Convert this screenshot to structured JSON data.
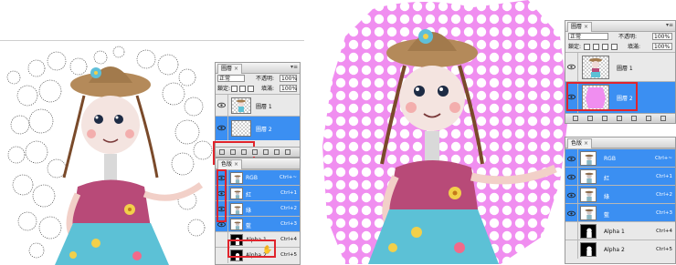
{
  "layers_panel": {
    "tab_label": "圖層",
    "close_glyph": "×",
    "menu_glyph": "▾≡",
    "blend_mode": "正常",
    "opacity_label": "不透明:",
    "opacity_value": "100%",
    "lock_label": "鎖定:",
    "fill_label": "填滿:",
    "fill_value": "100%",
    "layers": [
      {
        "name": "圖層 1",
        "visible": true
      },
      {
        "name": "圖層 2",
        "visible": true
      }
    ]
  },
  "channels_panel": {
    "tab_label": "色版",
    "close_glyph": "×",
    "channels": [
      {
        "name": "RGB",
        "shortcut": "Ctrl+~",
        "visible": true,
        "selected": true
      },
      {
        "name": "紅",
        "shortcut": "Ctrl+1",
        "visible": true,
        "selected": true
      },
      {
        "name": "綠",
        "shortcut": "Ctrl+2",
        "visible": true,
        "selected": true
      },
      {
        "name": "藍",
        "shortcut": "Ctrl+3",
        "visible": true,
        "selected": true
      },
      {
        "name": "Alpha 1",
        "shortcut": "Ctrl+4",
        "visible": false,
        "selected": false
      },
      {
        "name": "Alpha 2",
        "shortcut": "Ctrl+5",
        "visible": false,
        "selected": false
      }
    ]
  },
  "colors": {
    "selection_blue": "#3b8ff2",
    "highlight_red": "#e0242c",
    "halftone_pink": "#f08ef0",
    "panel_gray": "#e9e9e9"
  },
  "icons": [
    "eye-icon",
    "lock-icon",
    "chain-link-icon",
    "fx-icon",
    "mask-icon",
    "new-layer-icon",
    "trash-icon",
    "cursor-hand-icon"
  ]
}
